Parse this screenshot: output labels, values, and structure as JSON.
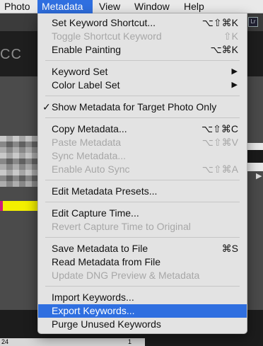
{
  "menubar": {
    "items": [
      "Photo",
      "Metadata",
      "View",
      "Window",
      "Help"
    ],
    "active_item": "Metadata"
  },
  "background": {
    "brand": "CC",
    "app_badge": "Lr",
    "status_left": "24",
    "status_right": "1"
  },
  "menu": {
    "items": [
      {
        "label": "Set Keyword Shortcut...",
        "shortcut": "⌥⇧⌘K"
      },
      {
        "label": "Toggle Shortcut Keyword",
        "shortcut": "⇧K"
      },
      {
        "label": "Enable Painting",
        "shortcut": "⌥⌘K"
      },
      {
        "label": "Keyword Set"
      },
      {
        "label": "Color Label Set"
      },
      {
        "label": "Show Metadata for Target Photo Only"
      },
      {
        "label": "Copy Metadata...",
        "shortcut": "⌥⇧⌘C"
      },
      {
        "label": "Paste Metadata",
        "shortcut": "⌥⇧⌘V"
      },
      {
        "label": "Sync Metadata..."
      },
      {
        "label": "Enable Auto Sync",
        "shortcut": "⌥⇧⌘A"
      },
      {
        "label": "Edit Metadata Presets..."
      },
      {
        "label": "Edit Capture Time..."
      },
      {
        "label": "Revert Capture Time to Original"
      },
      {
        "label": "Save Metadata to File",
        "shortcut": "⌘S"
      },
      {
        "label": "Read Metadata from File"
      },
      {
        "label": "Update DNG Preview & Metadata"
      },
      {
        "label": "Import Keywords..."
      },
      {
        "label": "Export Keywords..."
      },
      {
        "label": "Purge Unused Keywords"
      }
    ],
    "check_glyph": "✓",
    "submenu_glyph": "▶",
    "highlight_color": "#2f6fe0"
  }
}
